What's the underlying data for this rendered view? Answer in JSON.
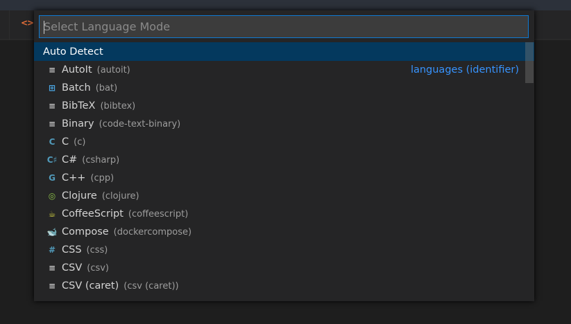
{
  "input": {
    "placeholder": "Select Language Mode"
  },
  "auto_detect": "Auto Detect",
  "items": [
    {
      "label": "AutoIt",
      "id": "(autoit)",
      "icon": "file-text-icon",
      "detail": "languages (identifier)"
    },
    {
      "label": "Batch",
      "id": "(bat)",
      "icon": "windows-icon"
    },
    {
      "label": "BibTeX",
      "id": "(bibtex)",
      "icon": "file-text-icon"
    },
    {
      "label": "Binary",
      "id": "(code-text-binary)",
      "icon": "file-text-icon"
    },
    {
      "label": "C",
      "id": "(c)",
      "icon": "c-icon"
    },
    {
      "label": "C#",
      "id": "(csharp)",
      "icon": "csharp-icon"
    },
    {
      "label": "C++",
      "id": "(cpp)",
      "icon": "cpp-icon"
    },
    {
      "label": "Clojure",
      "id": "(clojure)",
      "icon": "clojure-icon"
    },
    {
      "label": "CoffeeScript",
      "id": "(coffeescript)",
      "icon": "coffee-icon"
    },
    {
      "label": "Compose",
      "id": "(dockercompose)",
      "icon": "docker-icon"
    },
    {
      "label": "CSS",
      "id": "(css)",
      "icon": "hash-icon"
    },
    {
      "label": "CSV",
      "id": "(csv)",
      "icon": "file-text-icon"
    },
    {
      "label": "CSV (caret)",
      "id": "(csv (caret))",
      "icon": "file-text-icon"
    }
  ]
}
